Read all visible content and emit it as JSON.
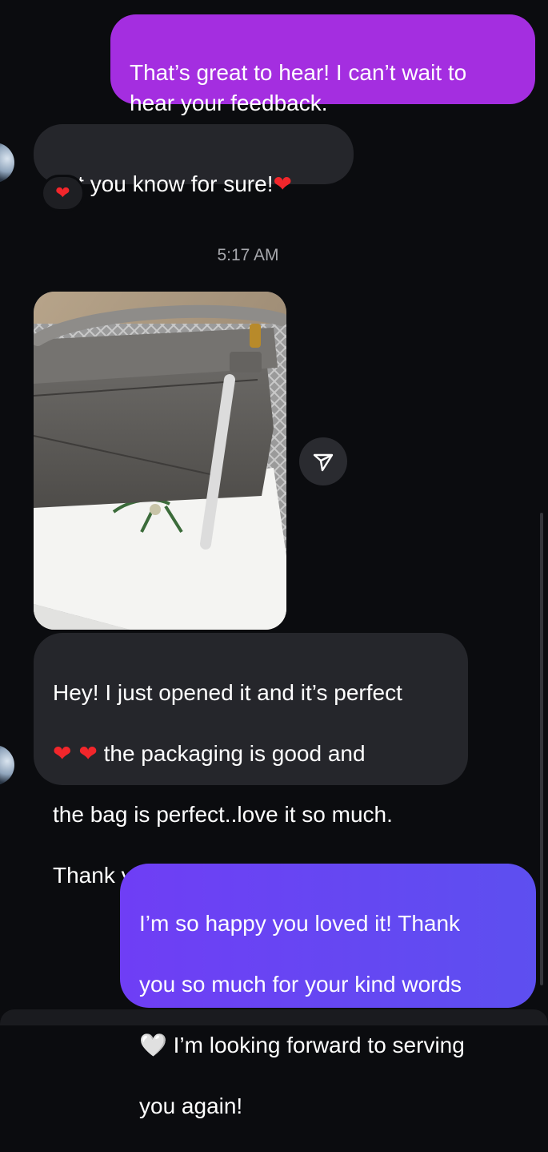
{
  "messages": {
    "outgoing_top": {
      "text": "That’s great to hear! I can’t wait to\nhear your feedback."
    },
    "incoming_1": {
      "text": "Let you know for sure!",
      "emoji": "❤",
      "reaction": "❤"
    },
    "timestamp": "5:17 AM",
    "incoming_2": {
      "line1": "Hey! I just opened it and it’s perfect",
      "emoji_pair": "❤ ❤",
      "line2_text": " the packaging is good and",
      "line3": "the bag is perfect..love it so much.",
      "line4": "Thank you",
      "line4_emoji": "❤"
    },
    "outgoing_bottom": {
      "line1": "I’m so happy you loved it! Thank",
      "line2": "you so much for your kind words",
      "line3_emoji": "🤍",
      "line3_text": " I’m looking forward to serving",
      "line4": "you again!"
    }
  },
  "icons": {
    "share": "paper-plane-icon",
    "reaction": "heart-icon",
    "avatar": "avatar"
  },
  "colors": {
    "background": "#0b0c0f",
    "outgoing_purple": "#a42ee0",
    "outgoing_violet": "#6f3ef5",
    "incoming_gray": "#25262b",
    "heart_red": "#f2262b",
    "timestamp_gray": "#a7a8ad"
  }
}
